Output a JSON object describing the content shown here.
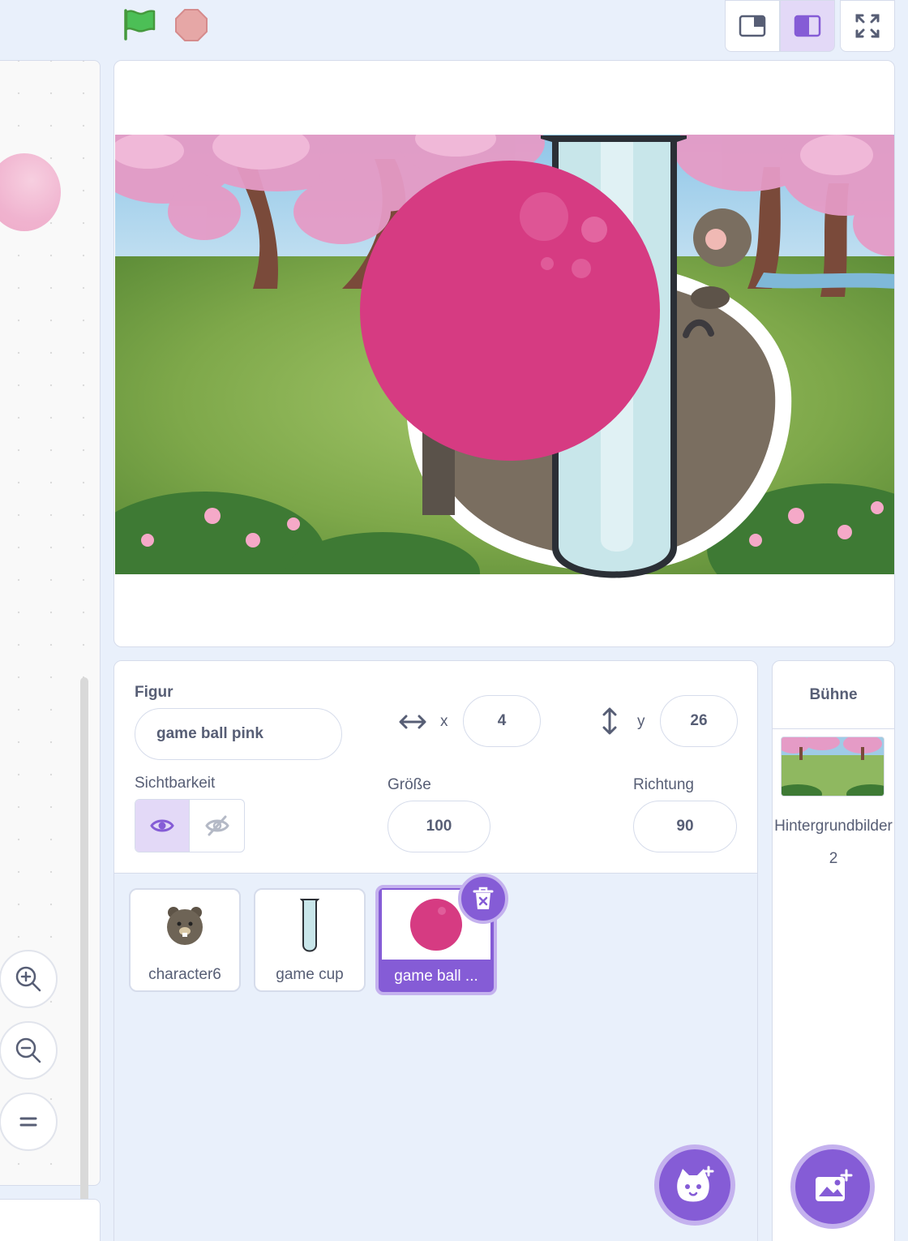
{
  "controls": {
    "green_flag_icon": "green-flag-icon",
    "stop_icon": "stop-sign-icon"
  },
  "colors": {
    "accent": "#855cd6",
    "accent_light": "#c4b1ee",
    "ball": "#d63b82",
    "text": "#575e75",
    "panel_bg": "#e9f0fb"
  },
  "sprite_info": {
    "sprite_label": "Figur",
    "sprite_name": "game ball pink",
    "x_label": "x",
    "x_value": "4",
    "y_label": "y",
    "y_value": "26",
    "visibility_label": "Sichtbarkeit",
    "size_label": "Größe",
    "size_value": "100",
    "direction_label": "Richtung",
    "direction_value": "90"
  },
  "sprites": [
    {
      "name": "character6"
    },
    {
      "name": "game cup"
    },
    {
      "name": "game ball ..."
    }
  ],
  "stage_panel": {
    "title": "Bühne",
    "backdrops_label": "Hintergrundbilder",
    "backdrops_count": "2"
  }
}
